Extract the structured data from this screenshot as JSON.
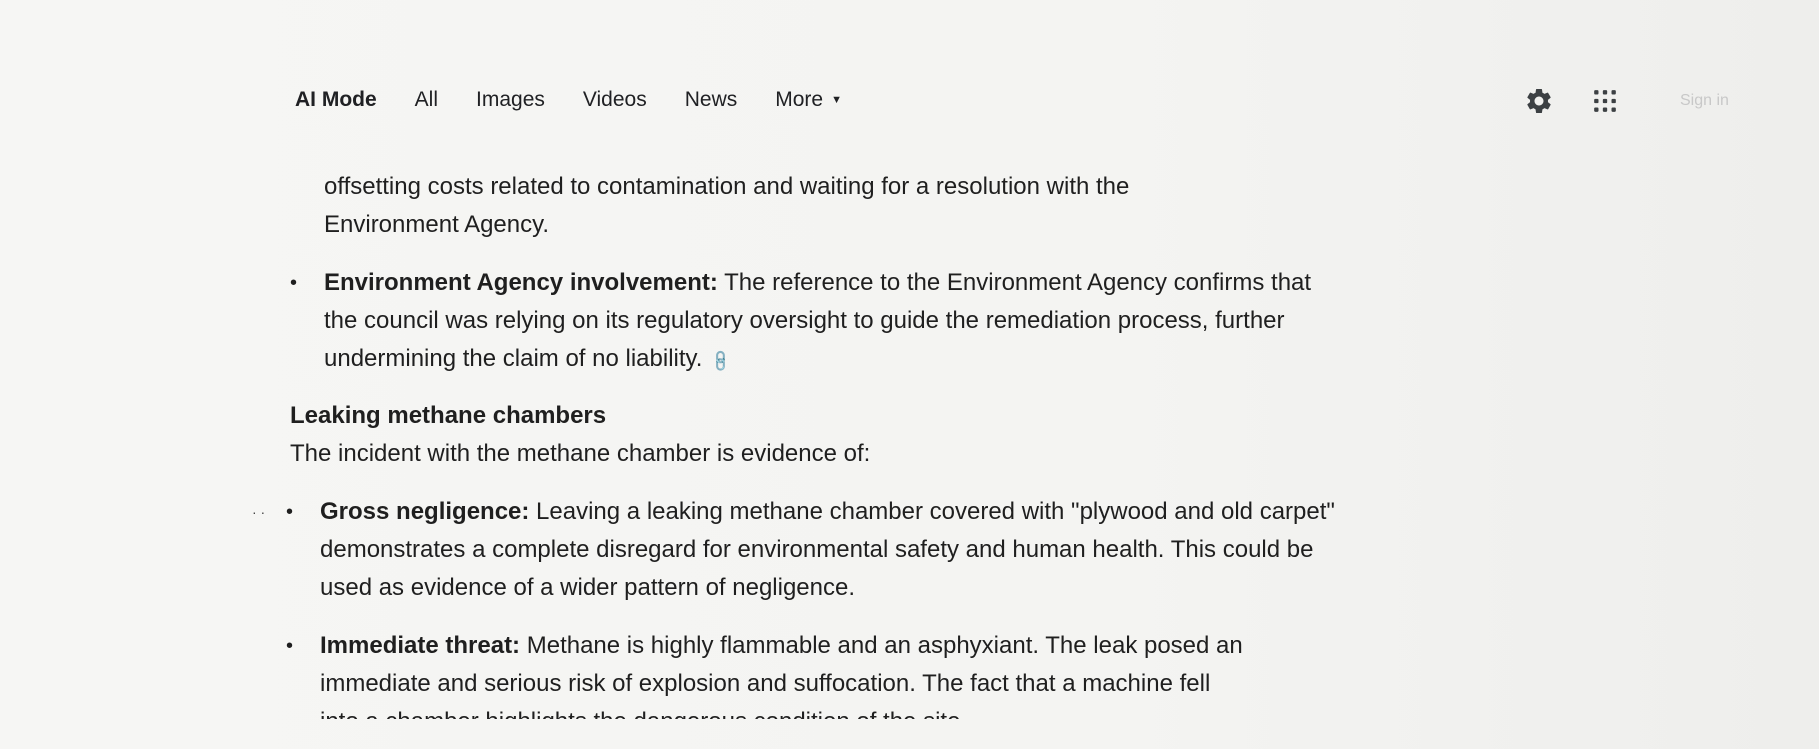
{
  "nav": {
    "tabs": [
      {
        "label": "AI Mode",
        "active": true
      },
      {
        "label": "All",
        "active": false
      },
      {
        "label": "Images",
        "active": false
      },
      {
        "label": "Videos",
        "active": false
      },
      {
        "label": "News",
        "active": false
      }
    ],
    "more_label": "More",
    "signin_label": "Sign in",
    "icons": [
      "gear-icon",
      "apps-grid-icon",
      "chevron-down-icon"
    ]
  },
  "content": {
    "intro_line1": "offsetting costs related to contamination and waiting for a resolution with the",
    "intro_line2": "Environment Agency.",
    "bullet1": {
      "bold": "Environment Agency involvement:",
      "text": " The reference to the Environment Agency confirms that the council was relying on its regulatory oversight to guide the remediation process, further undermining the claim of no liability."
    },
    "heading": "Leaking methane chambers",
    "heading_intro": "The incident with the methane chamber is evidence of:",
    "bullet2": {
      "bold": "Gross negligence:",
      "text": " Leaving a leaking methane chamber covered with \"plywood and old carpet\" demonstrates a complete disregard for environmental safety and human health. This could be used as evidence of a wider pattern of negligence."
    },
    "bullet3": {
      "bold": "Immediate threat:",
      "text": " Methane is highly flammable and an asphyxiant. The leak posed an immediate and serious risk of explosion and suffocation. The fact that a machine fell"
    },
    "bullet3_cutoff": "into a chamber highlights the dangerous condition of the site"
  },
  "colors": {
    "text": "#1f1f1f",
    "background": "#f4f4f2",
    "signin": "#c8c8c8"
  }
}
